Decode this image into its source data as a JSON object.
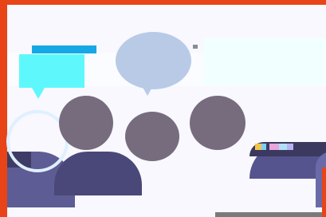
{
  "scene": {
    "colors": {
      "frame": "#e84418",
      "background": "#f8f8fe",
      "bubble_blue": "#16a8e6",
      "bubble_cyan": "#5ef8fc",
      "bubble_oval": "#b8cae6",
      "head": "#766c7e",
      "body": "#4f4d80"
    },
    "icons": [
      "speech-bubble-icon",
      "thought-bubble-icon",
      "person-icon"
    ]
  }
}
